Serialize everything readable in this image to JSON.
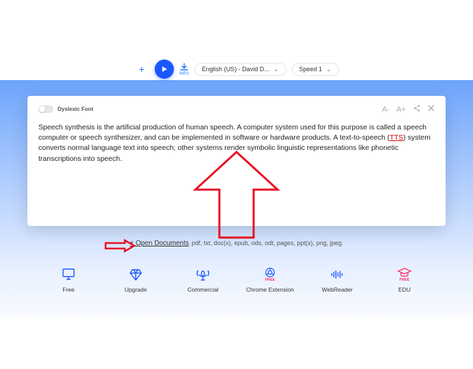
{
  "controls": {
    "add_label": "+",
    "download_label": "MP3",
    "voice": "English (US) - David D...",
    "speed_label": "Speed 1"
  },
  "card": {
    "dyslexic_font_label": "Dyslexic Font",
    "tools": {
      "font_dec": "A-",
      "font_inc": "A+"
    },
    "text_pre": "Speech synthesis is the artificial production of human speech. A computer system used for this purpose is called a speech computer or speech synthesizer, and can be implemented in software or hardware products. A text-to-speech (",
    "text_tts": "TTS",
    "text_post": ") system converts normal language text into speech; other systems render symbolic linguistic representations like phonetic transcriptions into speech."
  },
  "open_docs": {
    "link": "+ Open Documents",
    "formats": "pdf, txt, doc(x), epub, ods, odt, pages, ppt(x), png, jpeg."
  },
  "icons": {
    "free": "Free",
    "upgrade": "Upgrade",
    "commercial": "Commercial",
    "chrome_free": "FREE",
    "chrome": "Chrome Extension",
    "webreader": "WebReader",
    "edu_free": "FREE",
    "edu": "EDU"
  }
}
